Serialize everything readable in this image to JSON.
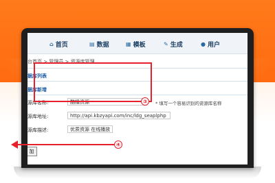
{
  "nav": {
    "items": [
      {
        "label": "首页",
        "icon": "home-icon",
        "glyph": "⌂"
      },
      {
        "label": "数据",
        "icon": "database-icon",
        "glyph": "▤"
      },
      {
        "label": "模板",
        "icon": "template-icon",
        "glyph": "▦"
      },
      {
        "label": "生成",
        "icon": "generate-icon",
        "glyph": "✎"
      },
      {
        "label": "用户",
        "icon": "user-icon",
        "glyph": "●"
      }
    ]
  },
  "breadcrumb": "台首页 > 管理员 > 资源库管理",
  "sections": {
    "list_title": "据库列表",
    "add_title": "据库新增"
  },
  "form": {
    "name_label": "源库名称:",
    "name_value": "酷播资源",
    "name_hint": "* 填写一个容易识别的资源库名称",
    "url_label": "源库地址:",
    "url_value": "http://api.kbzyapi.com/inc/ldg_seaplphp",
    "desc_label": "源库描述:",
    "desc_value": "优质资源 在线播放",
    "submit_label": "加"
  },
  "annotations": {
    "box_number": "③",
    "arrow_number": "④",
    "color": "#e5202a"
  },
  "colors": {
    "background_orange": "#ff7a1a",
    "nav_text": "#1d3f63",
    "section_title": "#1a5aa5"
  }
}
